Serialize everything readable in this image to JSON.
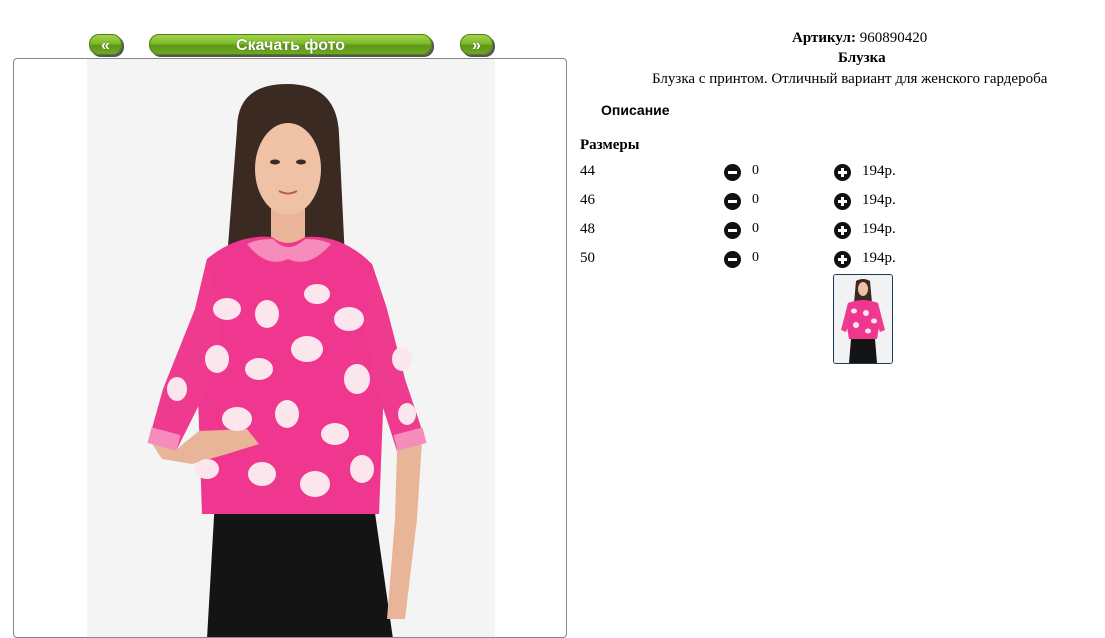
{
  "nav": {
    "prev_label": "«",
    "download_label": "Скачать фото",
    "next_label": "»"
  },
  "product": {
    "article_label": "Артикул:",
    "article_value": "960890420",
    "name": "Блузка",
    "description": "Блузка с принтом. Отличный вариант для женского гардероба",
    "description_tab": "Описание",
    "sizes_heading": "Размеры"
  },
  "sizes": [
    {
      "size": "44",
      "qty": "0",
      "price": "194р."
    },
    {
      "size": "46",
      "qty": "0",
      "price": "194р."
    },
    {
      "size": "48",
      "qty": "0",
      "price": "194р."
    },
    {
      "size": "50",
      "qty": "0",
      "price": "194р."
    }
  ],
  "colors": {
    "button_green": "#7fb92a",
    "blouse_pink": "#f0378f",
    "print_white": "#fbe6ee"
  },
  "icons": {
    "minus": "minus-circle-icon",
    "plus": "plus-circle-icon"
  }
}
